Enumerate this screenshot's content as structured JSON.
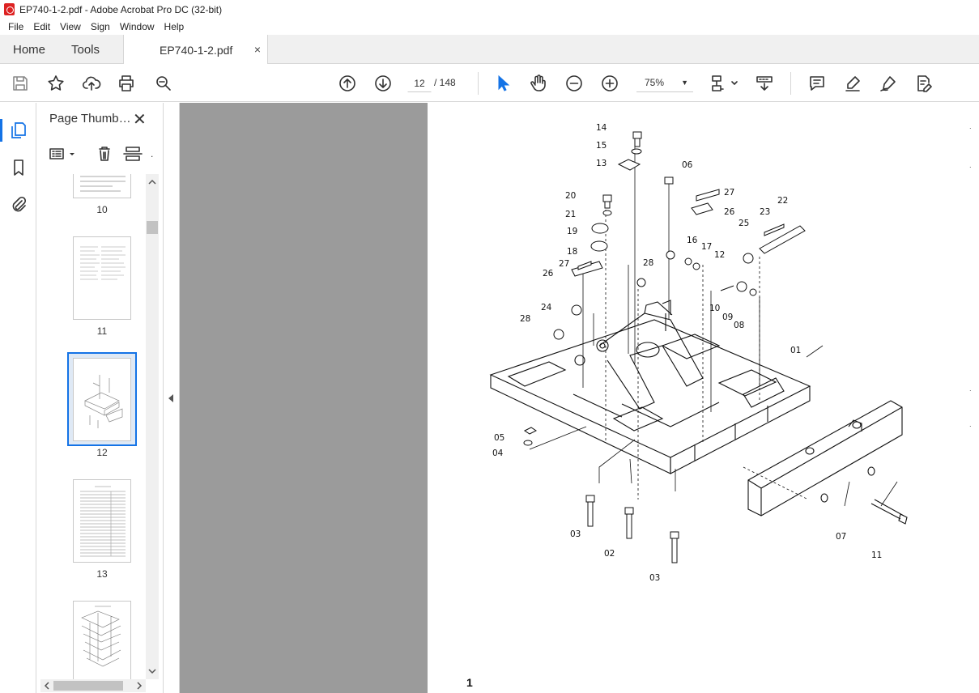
{
  "window": {
    "title": "EP740-1-2.pdf - Adobe Acrobat Pro DC (32-bit)"
  },
  "menu": [
    "File",
    "Edit",
    "View",
    "Sign",
    "Window",
    "Help"
  ],
  "tabs": {
    "home": "Home",
    "tools": "Tools",
    "document": "EP740-1-2.pdf",
    "close": "×"
  },
  "toolbar": {
    "page_current": "12",
    "page_total": "/ 148",
    "zoom": "75%",
    "icons": [
      "save-icon",
      "bookmark-star-icon",
      "upload-icon",
      "print-icon",
      "zoom-search-icon",
      "page-up-icon",
      "page-down-icon",
      "select-arrow-icon",
      "hand-icon",
      "zoom-out-icon",
      "zoom-in-icon",
      "fit-page-icon",
      "scroll-mode-icon",
      "comment-icon",
      "highlight-icon",
      "sign-icon",
      "edit-pdf-icon"
    ]
  },
  "panel": {
    "title": "Page Thumb…",
    "close": "✕",
    "thumbnails": [
      {
        "label": "10"
      },
      {
        "label": "11"
      },
      {
        "label": "12",
        "selected": true
      },
      {
        "label": "13"
      },
      {
        "label": ""
      }
    ]
  },
  "document": {
    "page_number": "1",
    "callouts": [
      "14",
      "15",
      "13",
      "06",
      "20",
      "27",
      "22",
      "21",
      "26",
      "23",
      "19",
      "25",
      "16",
      "18",
      "17",
      "12",
      "27",
      "28",
      "26",
      "10",
      "09",
      "08",
      "24",
      "28",
      "01",
      "05",
      "04",
      "03",
      "02",
      "03",
      "07",
      "11"
    ]
  }
}
